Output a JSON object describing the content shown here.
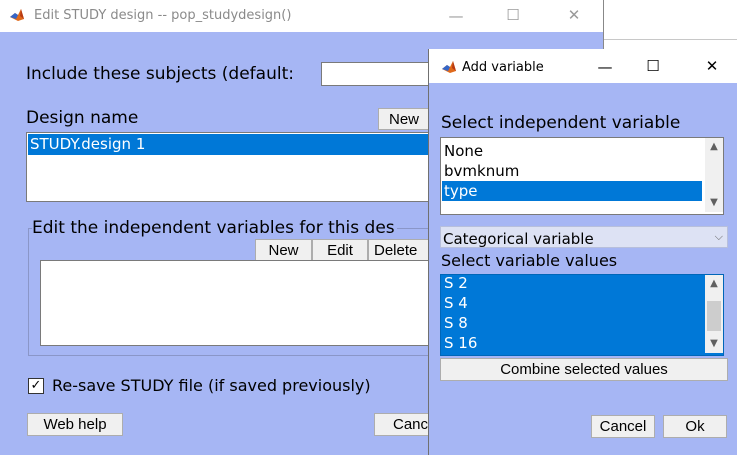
{
  "background_window": {
    "title": "",
    "controls": {
      "min": "—",
      "max": "☐",
      "close": "✕"
    }
  },
  "edit_window": {
    "title": "Edit STUDY design -- pop_studydesign()",
    "controls": {
      "min": "—",
      "max": "☐",
      "close": "✕"
    },
    "include_subjects_label": "Include these subjects (default:",
    "include_subjects_value": "",
    "design_name_label": "Design name",
    "design_new_button": "New",
    "designs": [
      "STUDY.design 1"
    ],
    "selected_design": "STUDY.design 1",
    "edit_vars_label": "Edit the independent variables for this des",
    "var_new_button": "New",
    "var_edit_button": "Edit",
    "var_delete_button": "Delete",
    "resave_checked": "✓",
    "resave_label": "Re-save STUDY file (if saved previously)",
    "web_help_button": "Web help",
    "cancel_button": "Canc"
  },
  "add_variable_window": {
    "title": "Add variable",
    "controls": {
      "min": "—",
      "max": "☐",
      "close": "✕"
    },
    "select_indep_label": "Select independent variable",
    "indep_vars": [
      "None",
      "bvmknum",
      "type"
    ],
    "selected_indep": "type",
    "type_select_value": "Categorical variable",
    "select_values_label": "Select variable values",
    "values": [
      "S  2",
      "S  4",
      "S  8",
      "S  16"
    ],
    "combine_button": "Combine selected values",
    "cancel_button": "Cancel",
    "ok_button": "Ok"
  },
  "colors": {
    "panel_bg": "#a6b6f4",
    "selection": "#0078d7",
    "button_bg": "#f0f0f0"
  }
}
